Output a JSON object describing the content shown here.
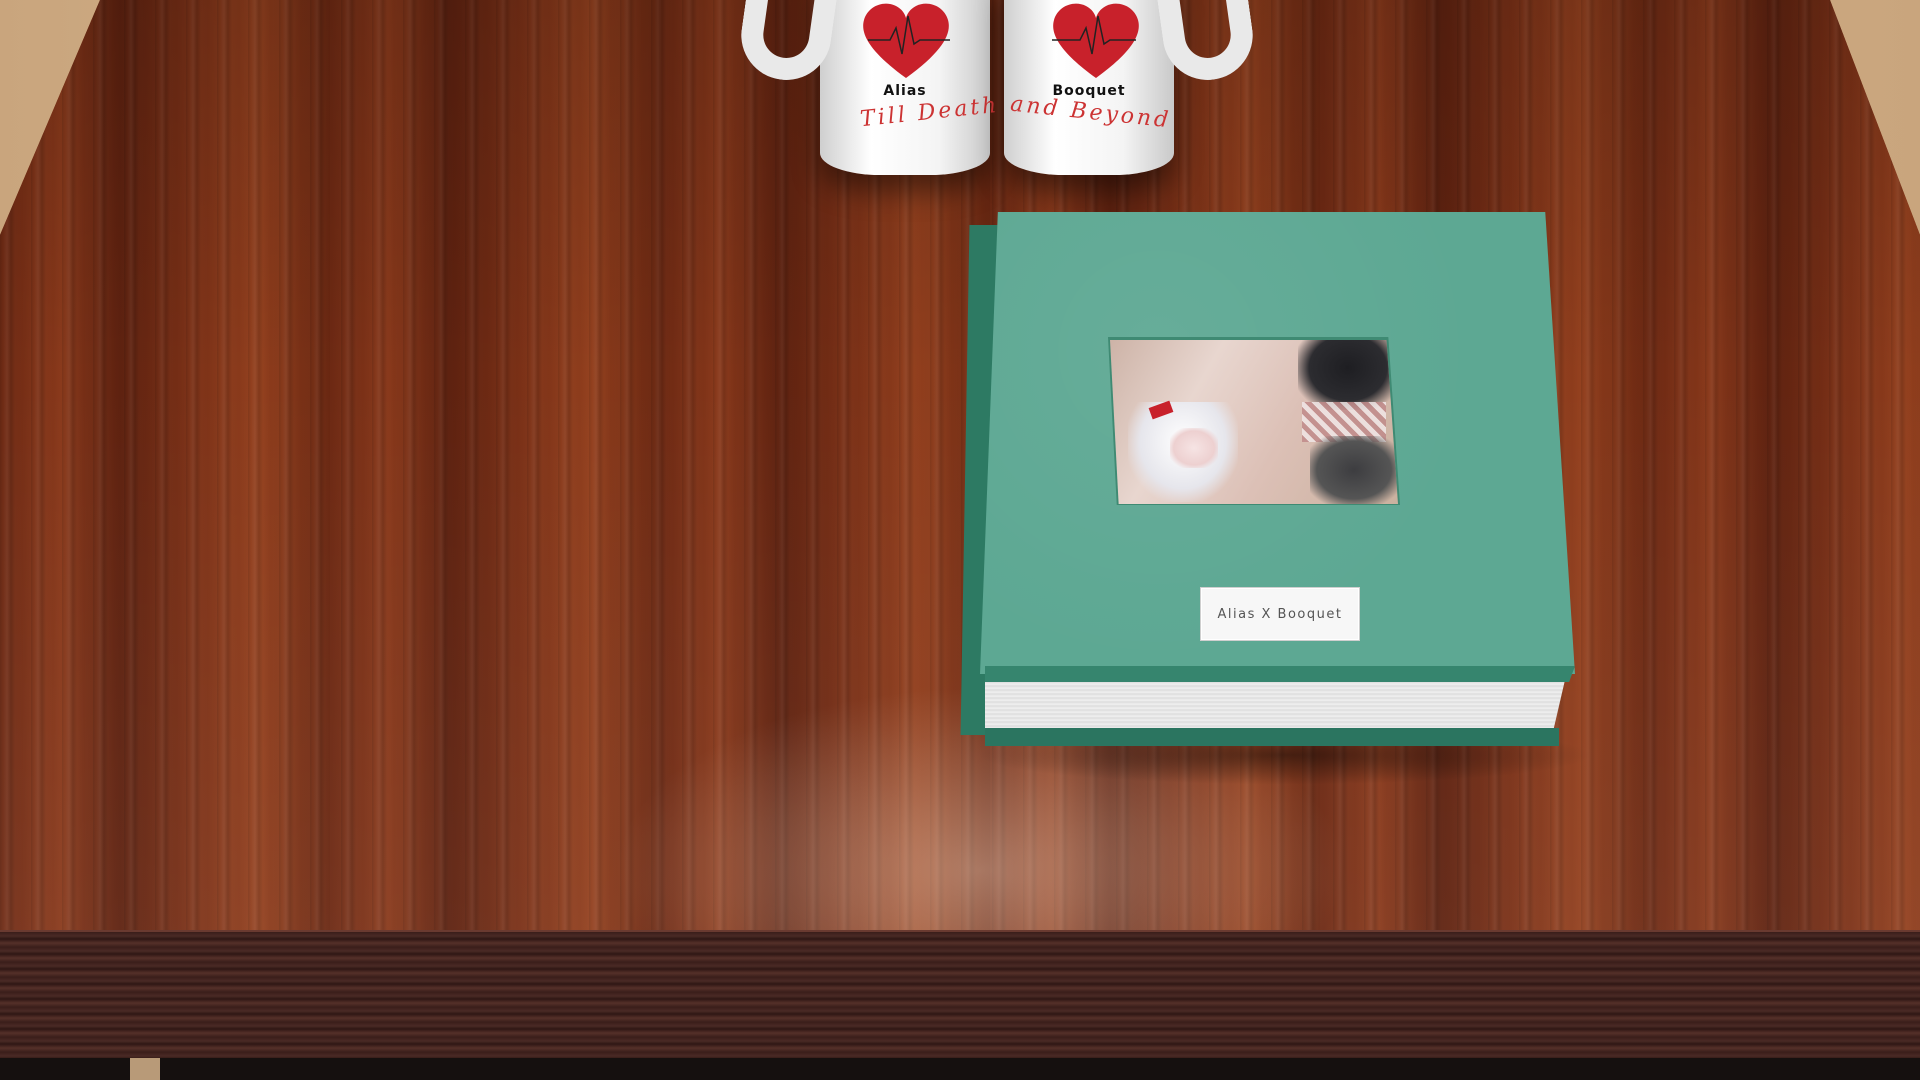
{
  "scene": {
    "description_colors": {
      "table_wood": "#7a3018",
      "book_cover": "#5da893",
      "heart": "#c8212b",
      "mug": "#f4f4f4"
    }
  },
  "mugs": [
    {
      "name": "Alias",
      "phrase": "Till Death"
    },
    {
      "name": "Booquet",
      "phrase": "and Beyond"
    }
  ],
  "book": {
    "label": "Alias X Booquet",
    "icons": [
      "heart-icon",
      "photo"
    ]
  }
}
